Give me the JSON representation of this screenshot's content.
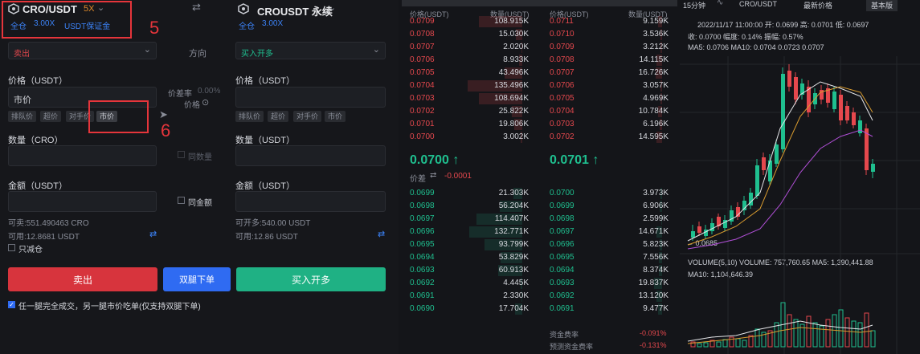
{
  "left_header": {
    "pair1": "CRO/USDT",
    "lev1": "5X",
    "tag1a": "全仓",
    "tag1b": "3.00X",
    "tag1c": "USDT保证金",
    "pair2": "CROUSDT 永续",
    "tag2a": "全仓",
    "tag2b": "3.00X"
  },
  "annotations": {
    "n5": "5",
    "n6": "6"
  },
  "form": {
    "side_left": "卖出",
    "direction_label": "方向",
    "side_right": "买入开多",
    "price_label_left": "价格（USDT）",
    "price_label_right": "价格（USDT）",
    "price_left_value": "市价",
    "spread_label": "价差率",
    "spread_value": "0.00%",
    "price_mid_label": "价格",
    "chips_left": [
      "排队价",
      "超价",
      "对手价",
      "市价"
    ],
    "chips_right": [
      "排队价",
      "超价",
      "对手价",
      "市价"
    ],
    "qty_label_left": "数量（CRO）",
    "qty_label_right": "数量（USDT）",
    "same_qty": "同数量",
    "amt_label_left": "金额（USDT）",
    "amt_label_right": "金额（USDT）",
    "same_amt": "同金额",
    "avail_left1": "可卖:551.490463 CRO",
    "avail_left2": "可用:12.8681 USDT",
    "avail_right1": "可开多:540.00 USDT",
    "avail_right2": "可用:12.86 USDT",
    "reduce_only": "只减仓",
    "btn_sell": "卖出",
    "btn_dual": "双腿下单",
    "btn_buy": "买入开多",
    "footnote": "任一腿完全成交，另一腿市价吃单(仅支持双腿下单)"
  },
  "orderbook": {
    "hdr_price_left": "价格(USDT)",
    "hdr_qty_left": "数量(USDT)",
    "hdr_price_right": "价格(USDT)",
    "hdr_qty_right": "数量(USDT)",
    "asks_left": [
      [
        "0.0709",
        "108.915K"
      ],
      [
        "0.0708",
        "15.030K"
      ],
      [
        "0.0707",
        "2.020K"
      ],
      [
        "0.0706",
        "8.933K"
      ],
      [
        "0.0705",
        "43.496K"
      ],
      [
        "0.0704",
        "135.496K"
      ],
      [
        "0.0703",
        "108.694K"
      ],
      [
        "0.0702",
        "25.822K"
      ],
      [
        "0.0701",
        "19.806K"
      ],
      [
        "0.0700",
        "3.002K"
      ]
    ],
    "asks_right": [
      [
        "0.0711",
        "9.159K"
      ],
      [
        "0.0710",
        "3.536K"
      ],
      [
        "0.0709",
        "3.212K"
      ],
      [
        "0.0708",
        "14.115K"
      ],
      [
        "0.0707",
        "16.726K"
      ],
      [
        "0.0706",
        "3.057K"
      ],
      [
        "0.0705",
        "4.969K"
      ],
      [
        "0.0704",
        "10.784K"
      ],
      [
        "0.0703",
        "6.196K"
      ],
      [
        "0.0702",
        "14.595K"
      ]
    ],
    "mid_left": "0.0700 ↑",
    "mid_right": "0.0701 ↑",
    "spread_label": "价差",
    "spread_value": "-0.0001",
    "bids_left": [
      [
        "0.0699",
        "21.303K"
      ],
      [
        "0.0698",
        "56.204K"
      ],
      [
        "0.0697",
        "114.407K"
      ],
      [
        "0.0696",
        "132.771K"
      ],
      [
        "0.0695",
        "93.799K"
      ],
      [
        "0.0694",
        "53.829K"
      ],
      [
        "0.0693",
        "60.913K"
      ],
      [
        "0.0692",
        "4.445K"
      ],
      [
        "0.0691",
        "2.330K"
      ],
      [
        "0.0690",
        "17.704K"
      ]
    ],
    "bids_right": [
      [
        "0.0700",
        "3.973K"
      ],
      [
        "0.0699",
        "6.906K"
      ],
      [
        "0.0698",
        "2.599K"
      ],
      [
        "0.0697",
        "14.671K"
      ],
      [
        "0.0696",
        "5.823K"
      ],
      [
        "0.0695",
        "7.556K"
      ],
      [
        "0.0694",
        "8.374K"
      ],
      [
        "0.0693",
        "19.837K"
      ],
      [
        "0.0692",
        "13.120K"
      ],
      [
        "0.0691",
        "9.477K"
      ]
    ],
    "funding_label": "资金费率",
    "funding_value": "-0.091%",
    "pred_label": "预测资金费率",
    "pred_value": "-0.131%"
  },
  "chart": {
    "interval": "15分钟",
    "pair": "CRO/USDT",
    "price_type": "最新价格",
    "version": "基本版",
    "info_line1": "2022/11/17 11:00:00  开: 0.0699  高: 0.0701  低: 0.0697",
    "info_line2": "收: 0.0700  幅度: 0.14%  振幅: 0.57%",
    "ma_line": "MA5: 0.0706  MA10: 0.0704  0.0723  0.0707",
    "low_marker": "← 0.0685",
    "volume_line": "VOLUME(5,10)  VOLUME: 757,760.65  MA5: 1,390,441.88",
    "ma10_line": "MA10: 1,104,646.39"
  }
}
